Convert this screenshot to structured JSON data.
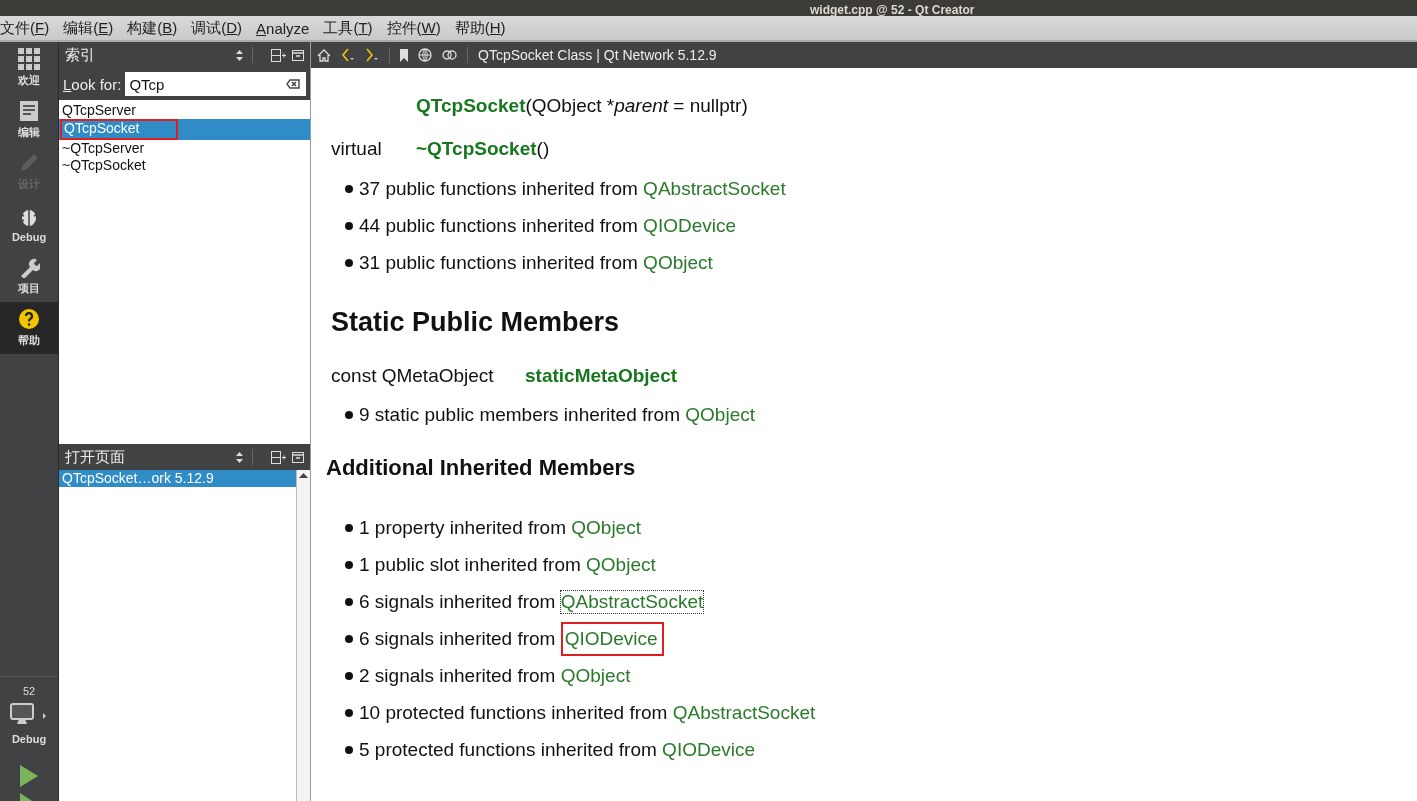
{
  "window": {
    "title": "widget.cpp @ 52 - Qt Creator"
  },
  "menu": [
    {
      "before": "文件(",
      "key": "F",
      "after": ")"
    },
    {
      "before": "编辑(",
      "key": "E",
      "after": ")"
    },
    {
      "before": "构建(",
      "key": "B",
      "after": ")"
    },
    {
      "before": "调试(",
      "key": "D",
      "after": ")"
    },
    {
      "key": "A",
      "after": "nalyze"
    },
    {
      "before": "工具(",
      "key": "T",
      "after": ")"
    },
    {
      "before": "控件(",
      "key": "W",
      "after": ")"
    },
    {
      "before": "帮助(",
      "key": "H",
      "after": ")"
    }
  ],
  "modes": [
    {
      "kind": "welcome",
      "label": "欢迎",
      "selected": false,
      "disabled": false
    },
    {
      "kind": "edit",
      "label": "编辑",
      "selected": false,
      "disabled": false
    },
    {
      "kind": "design",
      "label": "设计",
      "selected": false,
      "disabled": true
    },
    {
      "kind": "debug",
      "label": "Debug",
      "selected": false,
      "disabled": false
    },
    {
      "kind": "projects",
      "label": "项目",
      "selected": false,
      "disabled": false
    },
    {
      "kind": "help",
      "label": "帮助",
      "selected": true,
      "disabled": false
    }
  ],
  "target": {
    "project": "52",
    "config": "Debug"
  },
  "index_panel": {
    "title": "索引",
    "look_for": {
      "key": "L",
      "after": "ook for:"
    },
    "search": {
      "value": "QTcp"
    },
    "items": [
      {
        "label": "QTcpServer",
        "selected": false,
        "annotated": false
      },
      {
        "label": "QTcpSocket",
        "selected": true,
        "annotated": true
      },
      {
        "label": "~QTcpServer",
        "selected": false,
        "annotated": false
      },
      {
        "label": "~QTcpSocket",
        "selected": false,
        "annotated": false
      }
    ]
  },
  "open_pages": {
    "title": "打开页面",
    "items": [
      {
        "label": "QTcpSocket…ork 5.12.9",
        "selected": true
      }
    ]
  },
  "help_toolbar": {
    "page_title": "QTcpSocket Class | Qt Network 5.12.9"
  },
  "document": [
    {
      "kind": "signature",
      "name": "QTcpSocket",
      "args_before": "(QObject *",
      "param": "parent",
      "args_after": " = nullptr)"
    },
    {
      "kind": "signature",
      "qualifier": "virtual",
      "name": "~QTcpSocket",
      "args_before": "()"
    },
    {
      "kind": "bullet",
      "text": "37 public functions inherited from ",
      "link": "QAbstractSocket",
      "focused": false,
      "annotated": false
    },
    {
      "kind": "bullet",
      "text": "44 public functions inherited from ",
      "link": "QIODevice",
      "focused": false,
      "annotated": false
    },
    {
      "kind": "bullet",
      "text": "31 public functions inherited from ",
      "link": "QObject",
      "focused": false,
      "annotated": false
    },
    {
      "kind": "heading",
      "text": "Static Public Members"
    },
    {
      "kind": "member",
      "type": "const QMetaObject",
      "name": "staticMetaObject"
    },
    {
      "kind": "bullet",
      "text": "9 static public members inherited from ",
      "link": "QObject",
      "focused": false,
      "annotated": false
    },
    {
      "kind": "subheading",
      "text": "Additional Inherited Members"
    },
    {
      "kind": "bullet",
      "text": "1 property inherited from ",
      "link": "QObject",
      "focused": false,
      "annotated": false
    },
    {
      "kind": "bullet",
      "text": "1 public slot inherited from ",
      "link": "QObject",
      "focused": false,
      "annotated": false
    },
    {
      "kind": "bullet",
      "text": "6 signals inherited from ",
      "link": "QAbstractSocket",
      "focused": true,
      "annotated": false
    },
    {
      "kind": "bullet",
      "text": "6 signals inherited from ",
      "link": "QIODevice",
      "focused": false,
      "annotated": true
    },
    {
      "kind": "bullet",
      "text": "2 signals inherited from ",
      "link": "QObject",
      "focused": false,
      "annotated": false
    },
    {
      "kind": "bullet",
      "text": "10 protected functions inherited from ",
      "link": "QAbstractSocket",
      "focused": false,
      "annotated": false
    },
    {
      "kind": "bullet",
      "text": "5 protected functions inherited from ",
      "link": "QIODevice",
      "focused": false,
      "annotated": false
    }
  ]
}
